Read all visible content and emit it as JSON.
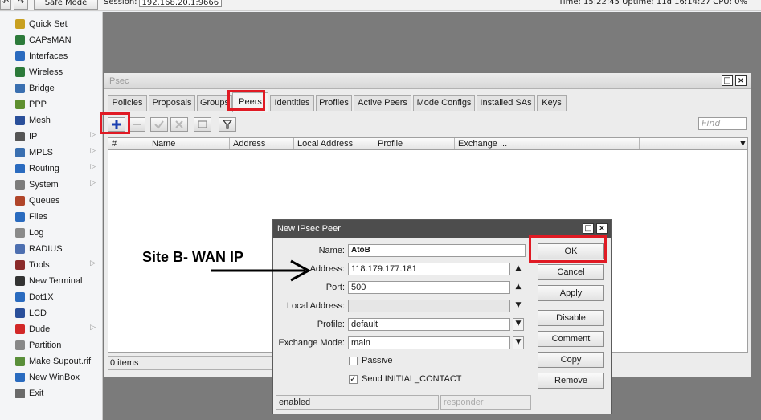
{
  "topbar": {
    "back": "↶",
    "forward": "↷",
    "safe_mode": "Safe Mode",
    "session_label": "Session:",
    "session_value": "192.168.20.1:9666",
    "status_text": "Time: 15:22:45  Uptime: 11d 16:14:27  CPU: 0%"
  },
  "sidebar": {
    "items": [
      {
        "label": "Quick Set",
        "icon": "wand-icon",
        "color": "#c8a020"
      },
      {
        "label": "CAPsMAN",
        "icon": "antenna-icon",
        "color": "#2c7a3a"
      },
      {
        "label": "Interfaces",
        "icon": "interfaces-icon",
        "color": "#2a6bbf"
      },
      {
        "label": "Wireless",
        "icon": "wireless-icon",
        "color": "#2c7a3a"
      },
      {
        "label": "Bridge",
        "icon": "bridge-icon",
        "color": "#3a6fb0"
      },
      {
        "label": "PPP",
        "icon": "ppp-icon",
        "color": "#5e8f2f"
      },
      {
        "label": "Mesh",
        "icon": "mesh-icon",
        "color": "#2a4f9a"
      },
      {
        "label": "IP",
        "icon": "ip-icon",
        "color": "#555555",
        "arrow": "▷"
      },
      {
        "label": "MPLS",
        "icon": "mpls-icon",
        "color": "#3a6fb0",
        "arrow": "▷"
      },
      {
        "label": "Routing",
        "icon": "routing-icon",
        "color": "#2a6bbf",
        "arrow": "▷"
      },
      {
        "label": "System",
        "icon": "gear-icon",
        "color": "#7c7c7c",
        "arrow": "▷"
      },
      {
        "label": "Queues",
        "icon": "queues-icon",
        "color": "#b0452a"
      },
      {
        "label": "Files",
        "icon": "folder-icon",
        "color": "#2a6bbf"
      },
      {
        "label": "Log",
        "icon": "log-icon",
        "color": "#8a8a8a"
      },
      {
        "label": "RADIUS",
        "icon": "radius-icon",
        "color": "#4d6fb0"
      },
      {
        "label": "Tools",
        "icon": "wrench-icon",
        "color": "#8a2a2a",
        "arrow": "▷"
      },
      {
        "label": "New Terminal",
        "icon": "terminal-icon",
        "color": "#333333"
      },
      {
        "label": "Dot1X",
        "icon": "dot1x-icon",
        "color": "#2a6bbf"
      },
      {
        "label": "LCD",
        "icon": "lcd-icon",
        "color": "#2a4f9a"
      },
      {
        "label": "Dude",
        "icon": "dude-icon",
        "color": "#d22828",
        "arrow": "▷"
      },
      {
        "label": "Partition",
        "icon": "partition-icon",
        "color": "#888888"
      },
      {
        "label": "Make Supout.rif",
        "icon": "supout-icon",
        "color": "#5a8f3a"
      },
      {
        "label": "New WinBox",
        "icon": "winbox-icon",
        "color": "#2a6bbf"
      },
      {
        "label": "Exit",
        "icon": "exit-icon",
        "color": "#6a6a6a"
      }
    ]
  },
  "ipsec": {
    "title": "IPsec",
    "tabs": [
      "Policies",
      "Proposals",
      "Groups",
      "Peers",
      "Identities",
      "Profiles",
      "Active Peers",
      "Mode Configs",
      "Installed SAs",
      "Keys"
    ],
    "find_placeholder": "Find",
    "columns": [
      "#",
      "Name",
      "Address",
      "Local Address",
      "Profile",
      "Exchange ..."
    ],
    "items_count": "0 items"
  },
  "dialog": {
    "title": "New IPsec Peer",
    "labels": {
      "name": "Name:",
      "address": "Address:",
      "port": "Port:",
      "local_address": "Local Address:",
      "profile": "Profile:",
      "exchange_mode": "Exchange Mode:",
      "passive": "Passive",
      "send_initial": "Send INITIAL_CONTACT"
    },
    "values": {
      "name": "AtoB",
      "address": "118.179.177.181",
      "port": "500",
      "local_address": "",
      "profile": "default",
      "exchange_mode": "main"
    },
    "buttons": [
      "OK",
      "Cancel",
      "Apply",
      "Disable",
      "Comment",
      "Copy",
      "Remove"
    ],
    "status_left": "enabled",
    "status_right": "responder"
  },
  "annotation": {
    "label": "Site B- WAN IP"
  },
  "colors": {
    "highlight": "#e01a24",
    "dialog_title": "#4d4d4d",
    "workspace": "#7b7b7b"
  }
}
